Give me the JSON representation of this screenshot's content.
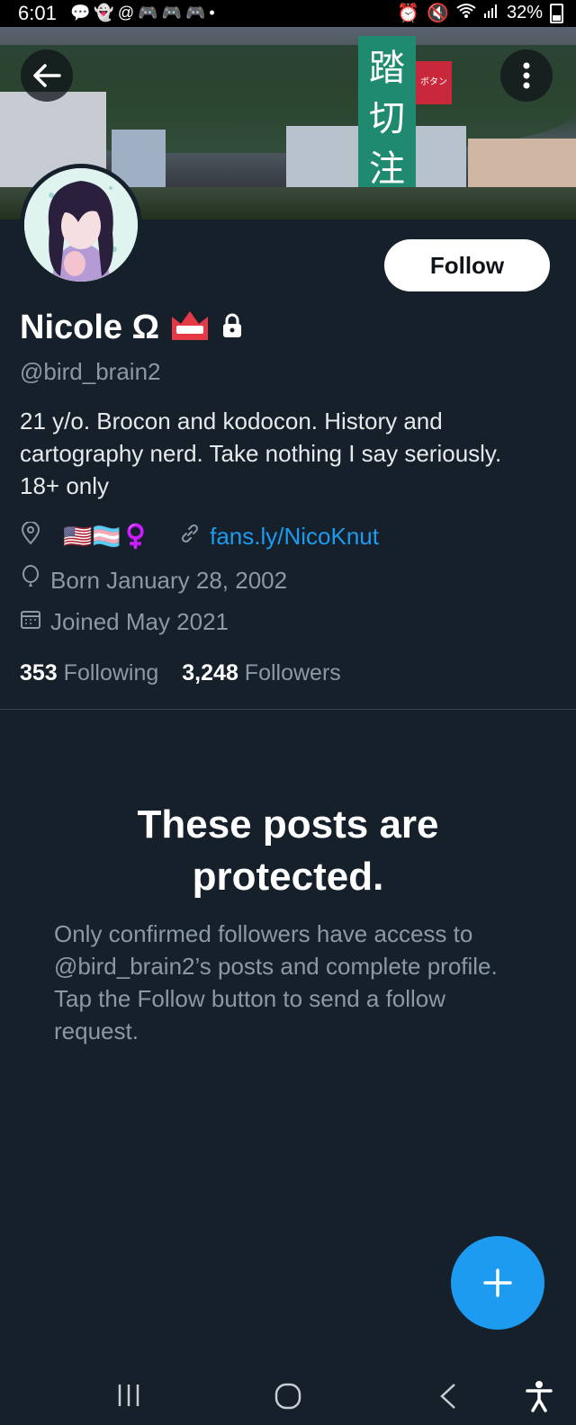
{
  "status_bar": {
    "time": "6:01",
    "battery": "32%",
    "notification_icons": [
      "chat-icon",
      "snapchat-icon",
      "threads-icon",
      "discord-icon",
      "discord-icon",
      "discord-icon",
      "dot-icon"
    ],
    "right_icons": [
      "alarm-icon",
      "mute-icon",
      "wifi-icon",
      "signal-icon"
    ]
  },
  "banner": {
    "sign_text": "踏\n切\n注\n意",
    "red_sign_text": "ボタン"
  },
  "profile": {
    "name": "Nicole Ω",
    "handle": "@bird_brain2",
    "bio": "21 y/o. Brocon and kodocon. History and\ncartography nerd. Take nothing I say seriously.\n18+ only",
    "location": "🇺🇸🏳️‍⚧️♀️",
    "website": "fans.ly/NicoKnut",
    "birthday": "Born January 28, 2002",
    "joined": "Joined May 2021",
    "following_count": "353",
    "following_label": "Following",
    "followers_count": "3,248",
    "followers_label": "Followers",
    "follow_button": "Follow"
  },
  "protected": {
    "title": "These posts are\nprotected.",
    "body": "Only confirmed followers have access to @bird_brain2’s posts and complete profile. Tap the Follow button to send a follow request."
  },
  "colors": {
    "background": "#15202b",
    "accent": "#1d9bf0",
    "muted_text": "#8b98a5"
  }
}
